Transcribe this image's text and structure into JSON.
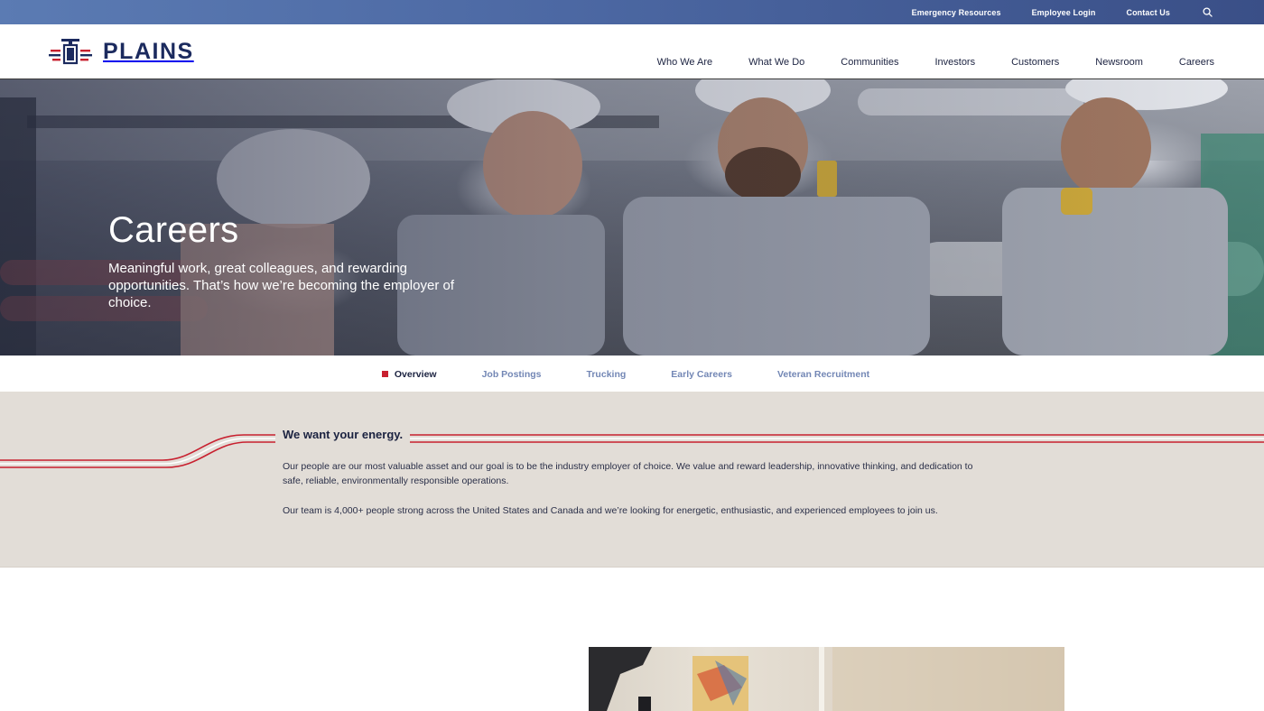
{
  "utility": {
    "links": [
      "Emergency Resources",
      "Employee Login",
      "Contact Us"
    ]
  },
  "brand": {
    "name": "PLAINS"
  },
  "nav": {
    "items": [
      "Who We Are",
      "What We Do",
      "Communities",
      "Investors",
      "Customers",
      "Newsroom",
      "Careers"
    ]
  },
  "hero": {
    "title": "Careers",
    "subtitle": "Meaningful work, great colleagues, and rewarding opportunities. That’s how we’re becoming the employer of choice."
  },
  "subnav": {
    "items": [
      "Overview",
      "Job Postings",
      "Trucking",
      "Early Careers",
      "Veteran Recruitment"
    ],
    "active": "Overview"
  },
  "energy": {
    "heading": "We want your energy.",
    "p1": "Our people are our most valuable asset and our goal is to be the industry employer of choice. We value and reward leadership, innovative thinking, and dedication to safe, reliable, environmentally responsible operations.",
    "p2": "Our team is 4,000+ people strong across the United States and Canada and we’re looking for energetic, enthusiastic, and experienced employees to join us."
  },
  "colors": {
    "brand_navy": "#1b2a5e",
    "accent_red": "#c8202f",
    "subnav_link": "#7387b5",
    "section_bg": "#e2ddd7"
  }
}
